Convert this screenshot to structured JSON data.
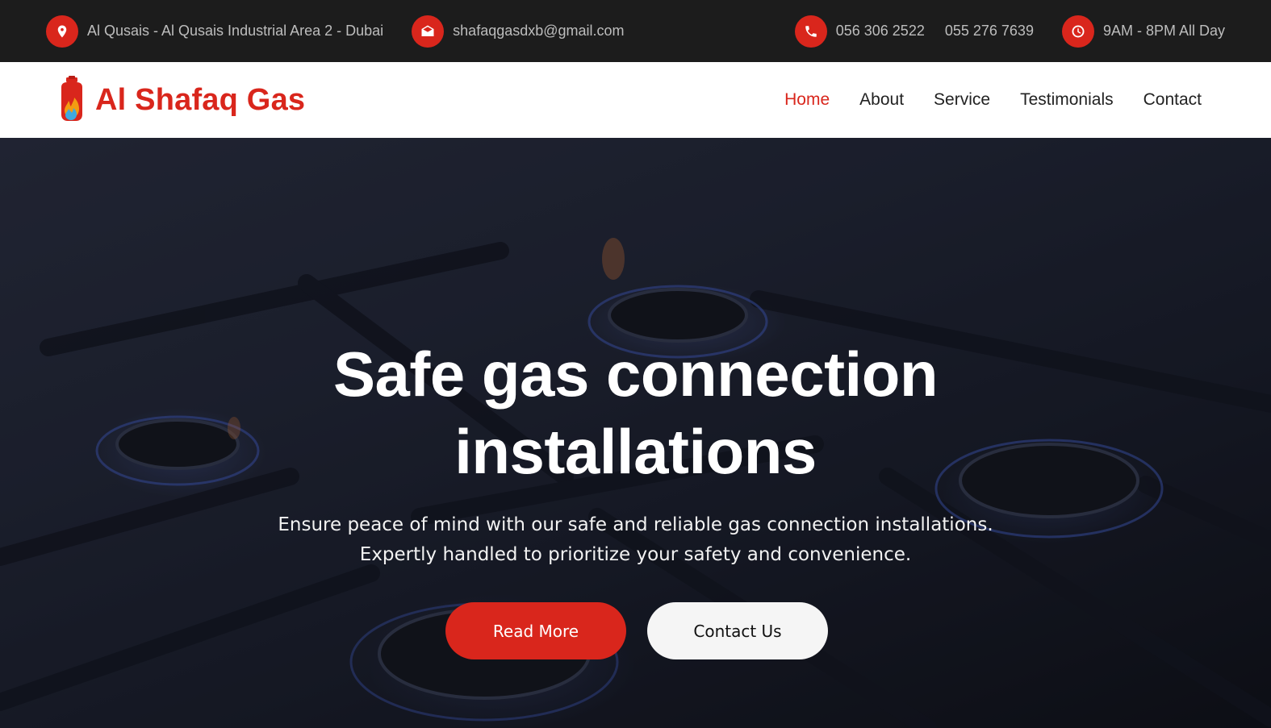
{
  "topbar": {
    "address": "Al Qusais - Al Qusais Industrial Area 2 - Dubai",
    "email": "shafaqgasdxb@gmail.com",
    "phone1": "056 306 2522",
    "phone2": "055 276 7639",
    "hours": "9AM - 8PM All Day",
    "icons": [
      "location-pin-icon",
      "envelope-icon",
      "phone-icon",
      "clock-icon"
    ]
  },
  "brand": {
    "name": "Al Shafaq Gas",
    "logo_icon": "gas-cylinder-flame-icon"
  },
  "nav": {
    "items": [
      {
        "label": "Home",
        "active": true
      },
      {
        "label": "About",
        "active": false
      },
      {
        "label": "Service",
        "active": false
      },
      {
        "label": "Testimonials",
        "active": false
      },
      {
        "label": "Contact",
        "active": false
      }
    ]
  },
  "hero": {
    "title_line1": "Safe gas connection",
    "title_line2": "installations",
    "subtitle_line1": "Ensure peace of mind with our safe and reliable gas connection installations.",
    "subtitle_line2": "Expertly handled to prioritize your safety and convenience.",
    "primary_button": "Read More",
    "secondary_button": "Contact Us"
  },
  "colors": {
    "accent": "#d9261c",
    "topbar_bg": "#1c1c1c",
    "nav_bg": "#ffffff",
    "text_dark": "#222222"
  }
}
